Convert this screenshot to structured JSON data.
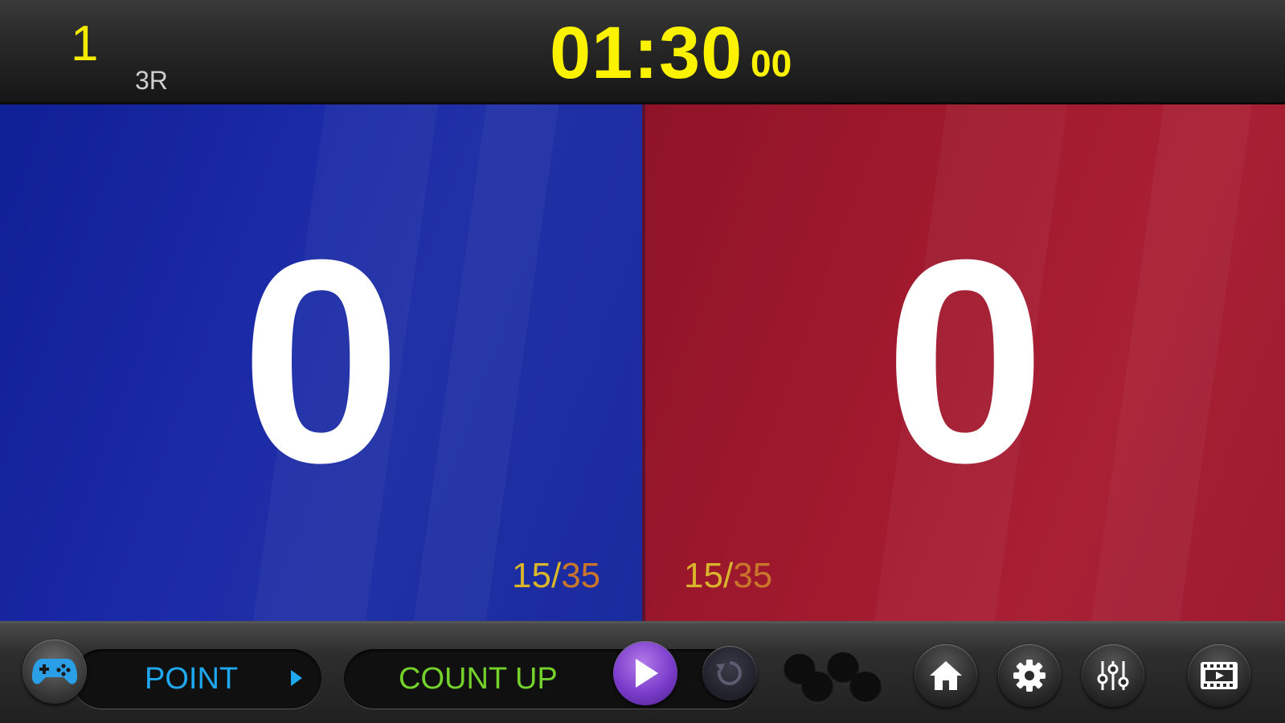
{
  "header": {
    "round_number": "1",
    "round_label": "3R",
    "timer": "01:30",
    "timer_fraction": "00"
  },
  "blue": {
    "score": "0",
    "fouls_current": "15",
    "fouls_separator": "/",
    "fouls_max": "35"
  },
  "red": {
    "score": "0",
    "fouls_current": "15",
    "fouls_separator": "/",
    "fouls_max": "35"
  },
  "toolbar": {
    "mode_label": "POINT",
    "count_label": "COUNT UP",
    "icons": [
      "gamepad-icon",
      "play-icon",
      "reset-icon",
      "dots-icon",
      "home-icon",
      "gear-icon",
      "sliders-icon",
      "video-icon"
    ]
  },
  "colors": {
    "timer": "#fbf200",
    "blue_panel": "#1b2aa6",
    "red_panel": "#a21a2e",
    "mode_text": "#1fa8f0",
    "count_text": "#74d12c",
    "play_button": "#7a3ccb"
  }
}
